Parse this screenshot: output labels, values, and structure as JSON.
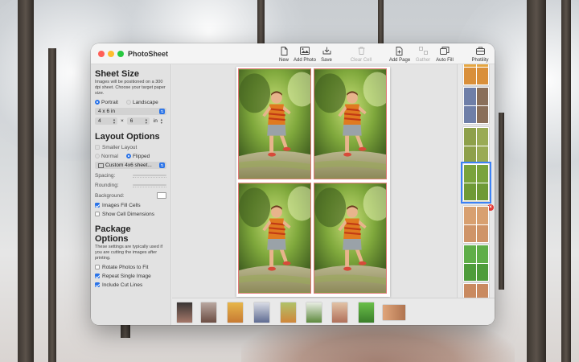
{
  "app": {
    "title": "PhotoSheet"
  },
  "toolbar": {
    "new_label": "New",
    "add_photo_label": "Add Photo",
    "save_label": "Save",
    "clear_cell_label": "Clear Cell",
    "add_page_label": "Add Page",
    "gather_label": "Gather",
    "auto_fill_label": "Auto Fill",
    "photility_label": "Photility"
  },
  "sheet_size": {
    "title": "Sheet Size",
    "description": "Images will be positioned on a 300 dpi sheet. Choose your target paper size.",
    "portrait_label": "Portrait",
    "landscape_label": "Landscape",
    "orientation": "Portrait",
    "size_value": "4 x 6 in",
    "width_value": "4",
    "times": "×",
    "height_value": "6",
    "unit_value": "in"
  },
  "layout_options": {
    "title": "Layout Options",
    "smaller_layout_label": "Smaller Layout",
    "smaller_layout_checked": false,
    "normal_label": "Normal",
    "flipped_label": "Flipped",
    "mode": "Flipped",
    "layout_value": "Custom 4x6 sheet...",
    "spacing_label": "Spacing:",
    "rounding_label": "Rounding:",
    "background_label": "Background:",
    "images_fill_cells_label": "Images Fill Cells",
    "images_fill_cells_checked": true,
    "show_cell_dimensions_label": "Show Cell Dimensions",
    "show_cell_dimensions_checked": false
  },
  "package_options": {
    "title": "Package Options",
    "description": "These settings are typically used if you are cutting the images after printing.",
    "rotate_label": "Rotate Photos to Fit",
    "rotate_checked": false,
    "repeat_label": "Repeat Single Image",
    "repeat_checked": true,
    "cut_lines_label": "Include Cut Lines",
    "cut_lines_checked": true
  },
  "colors": {
    "accent": "#2a73e8",
    "cut_line": "#e07878",
    "remove_badge": "#e53935"
  }
}
